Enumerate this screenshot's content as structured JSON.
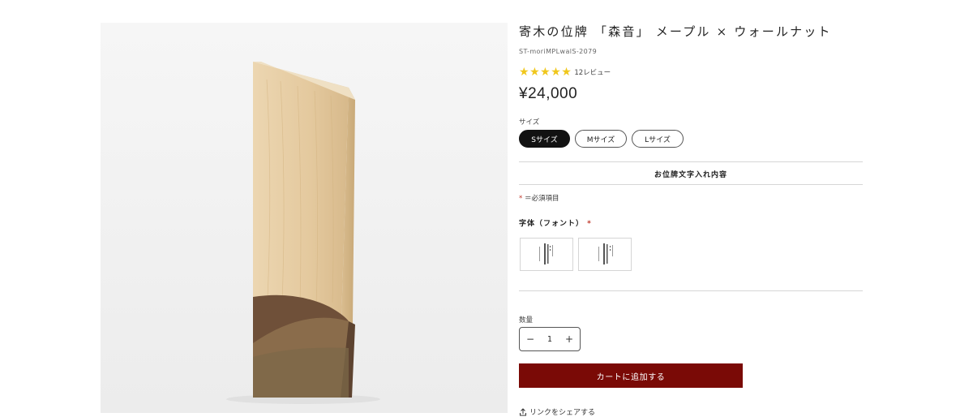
{
  "product": {
    "title": "寄木の位牌 「森音」 メープル × ウォールナット",
    "sku": "ST-moriMPLwalS-2079",
    "rating": {
      "stars": 5,
      "review_label": "12レビュー"
    },
    "price": "¥24,000",
    "image": {
      "name": "product-photo",
      "colors": {
        "background": "#f4f4f4",
        "maple": "#e2c8a0",
        "walnut": "#6b4f3a"
      }
    }
  },
  "size": {
    "label": "サイズ",
    "options": [
      "Sサイズ",
      "Mサイズ",
      "Lサイズ"
    ],
    "selected": "Sサイズ"
  },
  "inscription": {
    "heading": "お位牌文字入れ内容",
    "required_marker": "*",
    "required_note": "＝必須項目",
    "font_label": "字体（フォント）",
    "font_options": [
      {
        "name": "font-option-1"
      },
      {
        "name": "font-option-2"
      }
    ]
  },
  "quantity": {
    "label": "数量",
    "value": "1",
    "minus": "−",
    "plus": "+"
  },
  "cart": {
    "add_label": "カートに追加する"
  },
  "share": {
    "label": "リンクをシェアする",
    "icon": "share-icon"
  },
  "colors": {
    "accent": "#7a0a06",
    "star": "#f0c71c",
    "selected_pill": "#121212"
  }
}
